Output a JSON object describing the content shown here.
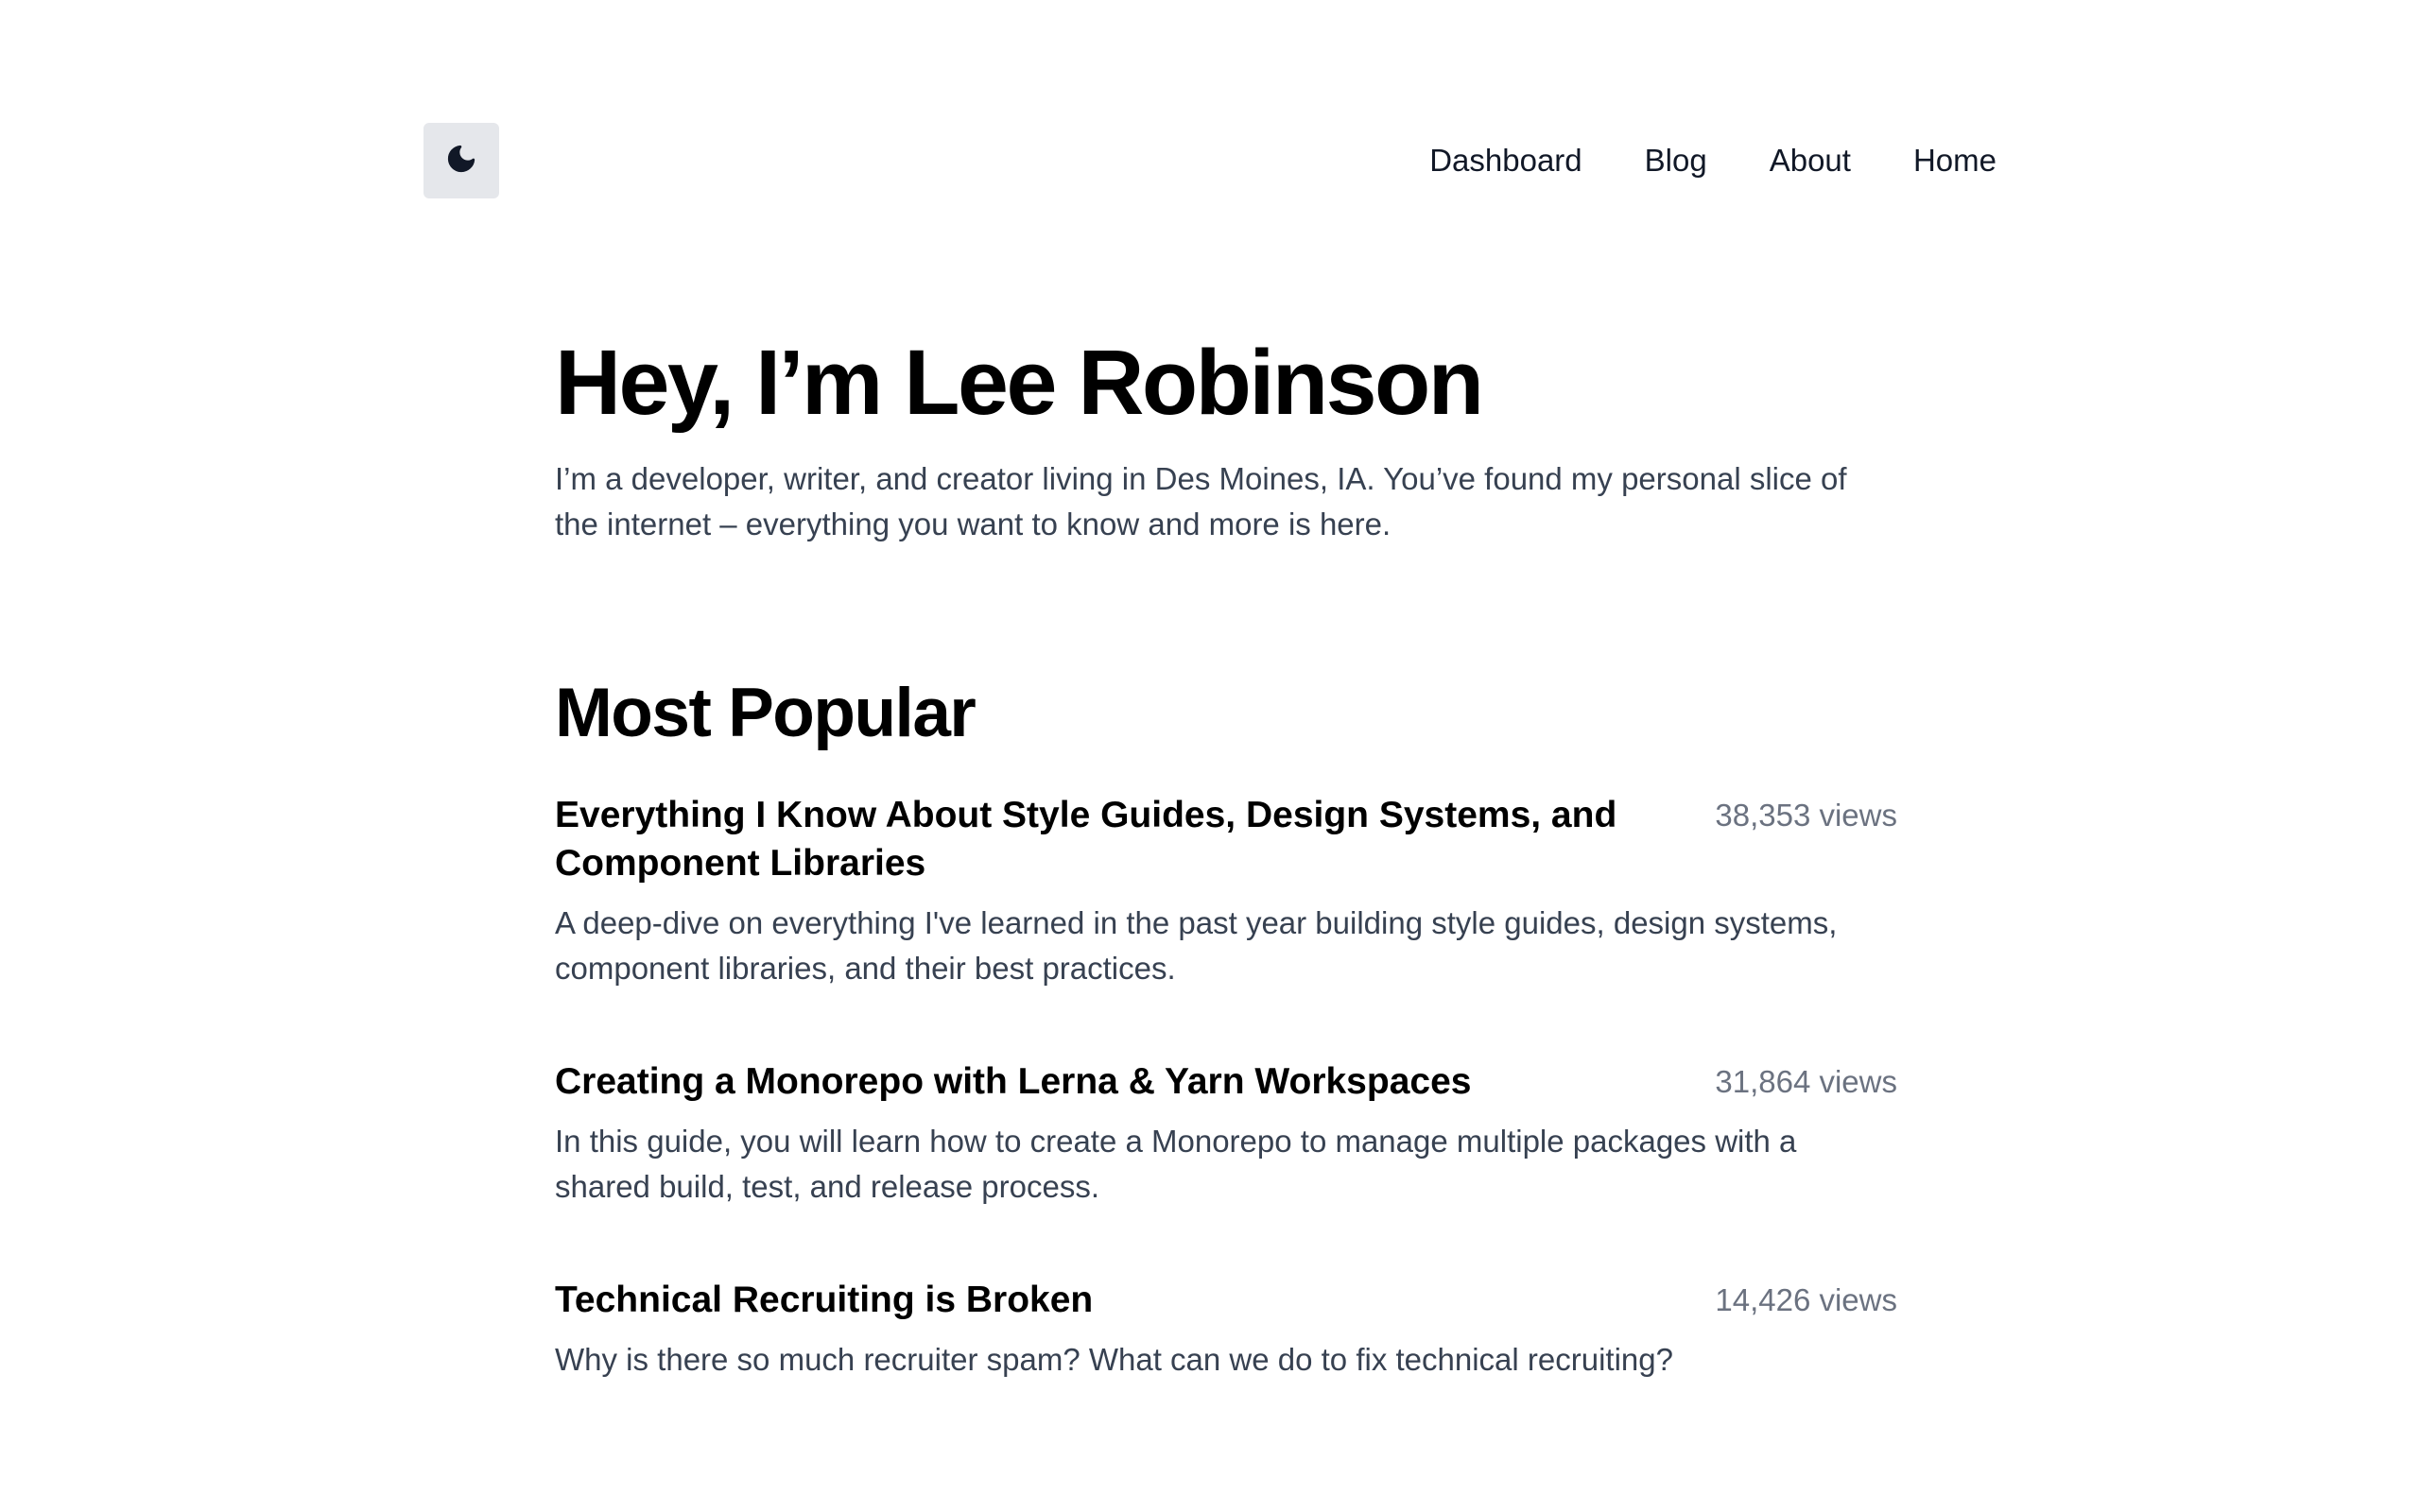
{
  "nav": {
    "theme_toggle_icon": "moon-icon",
    "links": [
      {
        "label": "Dashboard"
      },
      {
        "label": "Blog"
      },
      {
        "label": "About"
      },
      {
        "label": "Home"
      }
    ]
  },
  "hero": {
    "title": "Hey, I’m Lee Robinson",
    "subtitle": "I’m a developer, writer, and creator living in Des Moines, IA. You’ve found my personal slice of the internet – everything you want to know and more is here."
  },
  "popular": {
    "heading": "Most Popular",
    "posts": [
      {
        "title": "Everything I Know About Style Guides, Design Systems, and Component Libraries",
        "views": "38,353 views",
        "description": "A deep-dive on everything I've learned in the past year building style guides, design systems, component libraries, and their best practices."
      },
      {
        "title": "Creating a Monorepo with Lerna & Yarn Workspaces",
        "views": "31,864 views",
        "description": "In this guide, you will learn how to create a Monorepo to manage multiple packages with a shared build, test, and release process."
      },
      {
        "title": "Technical Recruiting is Broken",
        "views": "14,426 views",
        "description": "Why is there so much recruiter spam? What can we do to fix technical recruiting?"
      }
    ]
  },
  "colors": {
    "background": "#ffffff",
    "toggle_bg": "#e5e7eb",
    "text_primary": "#000000",
    "text_body": "#374151",
    "text_muted": "#6b7280"
  }
}
